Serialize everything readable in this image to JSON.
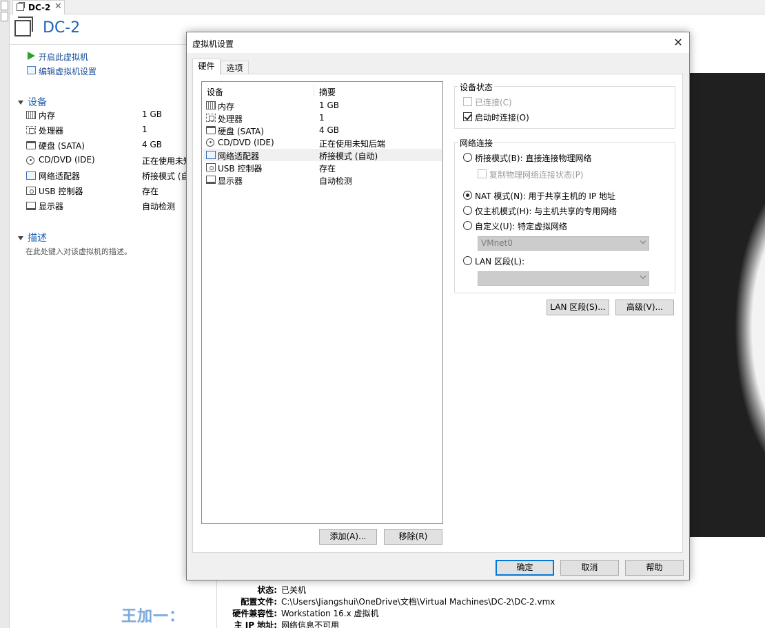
{
  "tab": {
    "title": "DC-2",
    "close": "✕"
  },
  "vm": {
    "name": "DC-2"
  },
  "actions": {
    "power_on": "开启此虚拟机",
    "edit_settings": "编辑虚拟机设置"
  },
  "devices_section": {
    "title": "设备",
    "items": [
      {
        "icon": "memory-icon",
        "name": "内存",
        "value": "1 GB"
      },
      {
        "icon": "processor-icon",
        "name": "处理器",
        "value": "1"
      },
      {
        "icon": "hard-disk-icon",
        "name": "硬盘 (SATA)",
        "value": "4 GB"
      },
      {
        "icon": "cd-dvd-icon",
        "name": "CD/DVD (IDE)",
        "value": "正在使用未知后端"
      },
      {
        "icon": "network-adapter-icon",
        "name": "网络适配器",
        "value": "桥接模式 (自动)"
      },
      {
        "icon": "usb-controller-icon",
        "name": "USB 控制器",
        "value": "存在"
      },
      {
        "icon": "display-icon",
        "name": "显示器",
        "value": "自动检测"
      }
    ]
  },
  "description_section": {
    "title": "描述",
    "placeholder": "在此处键入对该虚拟机的描述。"
  },
  "details": [
    {
      "key": "状态:",
      "value": "已关机"
    },
    {
      "key": "配置文件:",
      "value": "C:\\Users\\Jiangshui\\OneDrive\\文档\\Virtual Machines\\DC-2\\DC-2.vmx"
    },
    {
      "key": "硬件兼容性:",
      "value": "Workstation 16.x 虚拟机"
    },
    {
      "key": "主 IP 地址:",
      "value": "网络信息不可用"
    }
  ],
  "watermark": "王加一：",
  "dialog": {
    "title": "虚拟机设置",
    "close": "✕",
    "tabs": {
      "hardware": "硬件",
      "options": "选项"
    },
    "list": {
      "col_device": "设备",
      "col_summary": "摘要",
      "rows": [
        {
          "icon": "memory-icon",
          "name": "内存",
          "value": "1 GB"
        },
        {
          "icon": "processor-icon",
          "name": "处理器",
          "value": "1"
        },
        {
          "icon": "hard-disk-icon",
          "name": "硬盘 (SATA)",
          "value": "4 GB"
        },
        {
          "icon": "cd-dvd-icon",
          "name": "CD/DVD (IDE)",
          "value": "正在使用未知后端"
        },
        {
          "icon": "network-adapter-icon",
          "name": "网络适配器",
          "value": "桥接模式 (自动)",
          "selected": true
        },
        {
          "icon": "usb-controller-icon",
          "name": "USB 控制器",
          "value": "存在"
        },
        {
          "icon": "display-icon",
          "name": "显示器",
          "value": "自动检测"
        }
      ]
    },
    "add_button": "添加(A)...",
    "remove_button": "移除(R)",
    "device_status": {
      "title": "设备状态",
      "connected": {
        "label": "已连接(C)",
        "checked": false,
        "disabled": true
      },
      "connect_on_power": {
        "label": "启动时连接(O)",
        "checked": true
      }
    },
    "network": {
      "title": "网络连接",
      "bridged": "桥接模式(B): 直接连接物理网络",
      "replicate": "复制物理网络连接状态(P)",
      "nat": "NAT 模式(N): 用于共享主机的 IP 地址",
      "host_only": "仅主机模式(H): 与主机共享的专用网络",
      "custom": "自定义(U): 特定虚拟网络",
      "custom_value": "VMnet0",
      "lan": "LAN 区段(L):",
      "lan_value": "",
      "selected": "nat"
    },
    "lan_segments_button": "LAN 区段(S)...",
    "advanced_button": "高级(V)...",
    "ok_button": "确定",
    "cancel_button": "取消",
    "help_button": "帮助"
  }
}
